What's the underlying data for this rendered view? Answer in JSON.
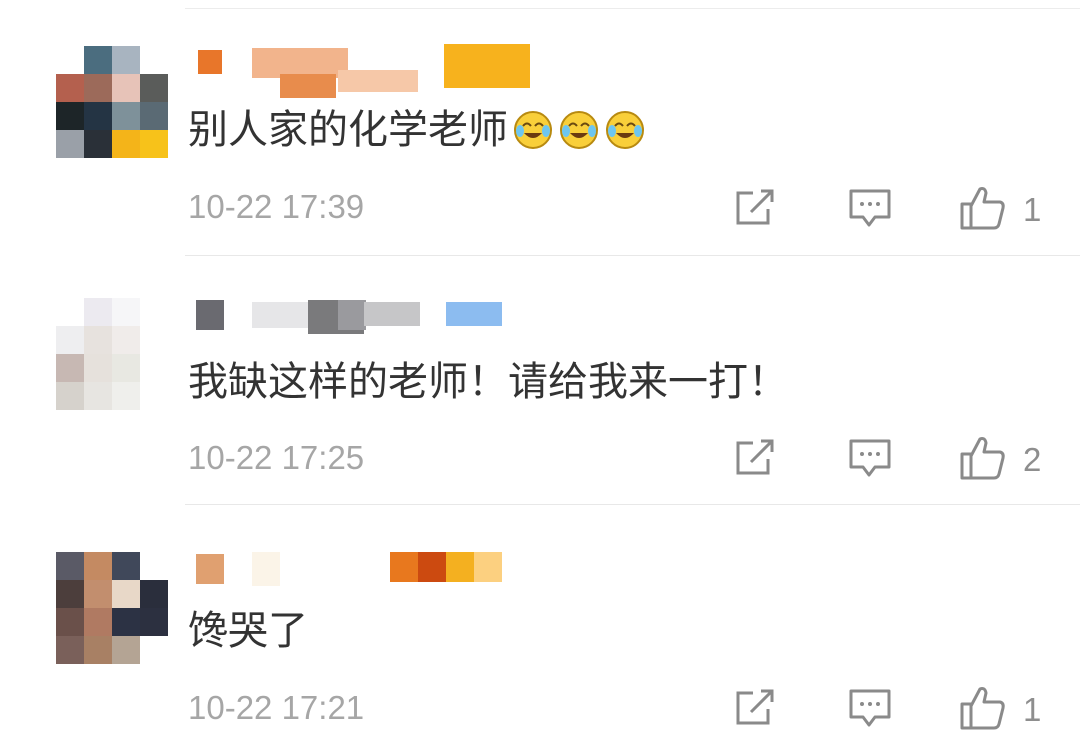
{
  "comments": [
    {
      "text": "别人家的化学老师",
      "emoji": [
        "laugh-cry-emoji",
        "laugh-cry-emoji",
        "laugh-cry-emoji"
      ],
      "time": "10-22 17:39",
      "likes": "1",
      "avatar_colors": [
        "#ffffff",
        "#4b6d7f",
        "#a8b4c0",
        "#ffffff",
        "#b4604e",
        "#9c6a5a",
        "#e7c3b8",
        "#5a5c5a",
        "#1d2528",
        "#243444",
        "#7e919a",
        "#5a6a74",
        "#9aa0a8",
        "#2a3038",
        "#f4b419",
        "#f7c21a"
      ],
      "name_blocks": [
        "#e8762a",
        "#f2b48c",
        "#e88c4c",
        "#f6c8a8",
        "#f0a040",
        "#f7b21d"
      ]
    },
    {
      "text": "我缺这样的老师！请给我来一打！",
      "emoji": [],
      "time": "10-22 17:25",
      "likes": "2",
      "avatar_colors": [
        "#ffffff",
        "#eceaf0",
        "#f6f6f8",
        "#ffffff",
        "#eeeef0",
        "#e7e2de",
        "#f0ecea",
        "#ffffff",
        "#c7b8b3",
        "#e6e1dc",
        "#e8e8e2",
        "#ffffff",
        "#d6d2cc",
        "#e7e5e1",
        "#efefec",
        "#ffffff"
      ],
      "name_blocks": [
        "#6a6a70",
        "#e6e6e8",
        "#7a7a7c",
        "#9a9a9e",
        "#c6c6c8",
        "#8cbcf0"
      ]
    },
    {
      "text": "馋哭了",
      "emoji": [],
      "time": "10-22 17:21",
      "likes": "1",
      "avatar_colors": [
        "#5a5a66",
        "#c48a62",
        "#40485a",
        "#ffffff",
        "#4c3e3c",
        "#c28e6e",
        "#e8d8c8",
        "#2a2e3c",
        "#6a504a",
        "#b07a62",
        "#2c3244",
        "#2c3040",
        "#7a605a",
        "#a88064",
        "#b4a494",
        "#ffffff"
      ],
      "name_blocks": [
        "#e0a070",
        "#fbf4e8",
        "#e8781e",
        "#cc4a10",
        "#f4b020",
        "#fcd080"
      ]
    }
  ]
}
